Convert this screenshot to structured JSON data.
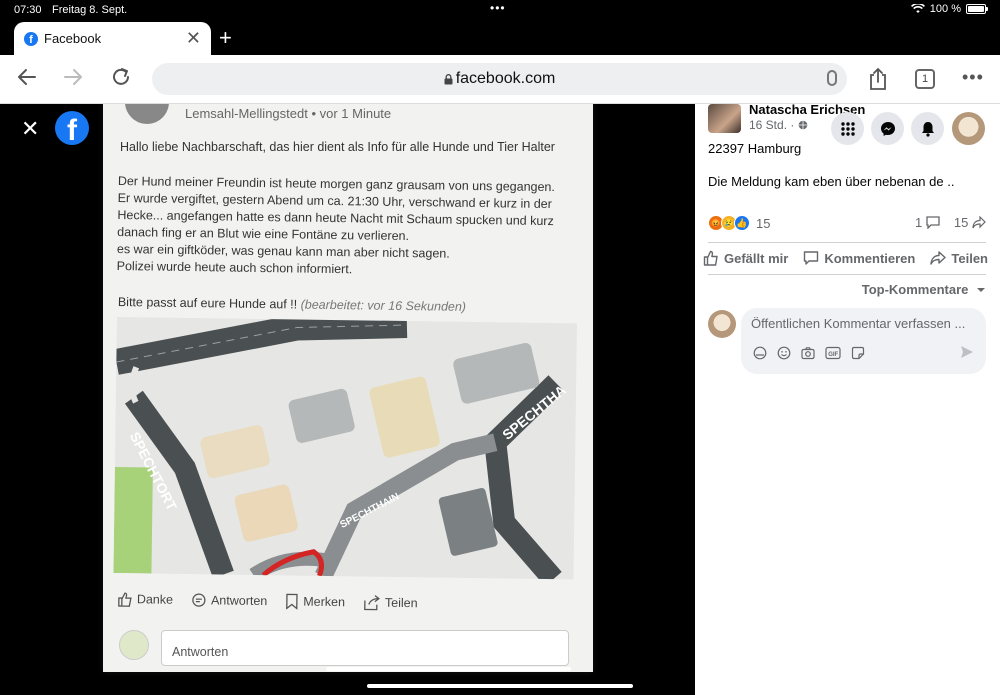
{
  "status": {
    "time": "07:30",
    "date": "Freitag 8. Sept.",
    "battery": "100 %"
  },
  "browser": {
    "tab_title": "Facebook",
    "new_tab": "+",
    "address": "facebook.com",
    "tab_count": "1"
  },
  "photo": {
    "location": "Lemsahl-Mellingstedt • vor 1 Minute",
    "greeting": "Hallo liebe Nachbarschaft, das hier dient als Info für alle Hunde und Tier Halter",
    "body": [
      "Der Hund meiner Freundin ist heute morgen ganz grausam von uns gegangen.",
      "Er wurde vergiftet, gestern Abend um ca. 21:30 Uhr, verschwand er kurz in der",
      "Hecke... angefangen hatte es dann heute Nacht mit Schaum spucken und kurz",
      "danach fing er an Blut wie eine Fontäne zu verlieren.",
      "es war ein giftköder, was genau kann man aber nicht sagen.",
      "Polizei wurde heute auch schon informiert."
    ],
    "warning": "Bitte passt auf eure Hunde auf !!",
    "edited": "(bearbeitet: vor 16 Sekunden)",
    "map_labels": {
      "street1": "SPECHTORT",
      "street2": "SPECHTHAIN",
      "street3": "SPECHTHA"
    },
    "actions": {
      "thanks": "Danke",
      "reply": "Antworten",
      "save": "Merken",
      "share": "Teilen"
    },
    "reply_placeholder": "Antworten"
  },
  "post": {
    "author": "Natascha Erichsen",
    "time": "16 Std. ·",
    "location": "22397 Hamburg",
    "text": "Die Meldung kam eben über nebenan de ..",
    "reaction_count": "15",
    "comment_count": "1",
    "share_count": "15",
    "actions": {
      "like": "Gefällt mir",
      "comment": "Kommentieren",
      "share": "Teilen"
    },
    "sort_label": "Top-Kommentare",
    "comment_placeholder": "Öffentlichen Kommentar verfassen ..."
  },
  "colors": {
    "facebook_blue": "#1877f2",
    "panel_bg": "#ffffff",
    "muted": "#65676b"
  }
}
